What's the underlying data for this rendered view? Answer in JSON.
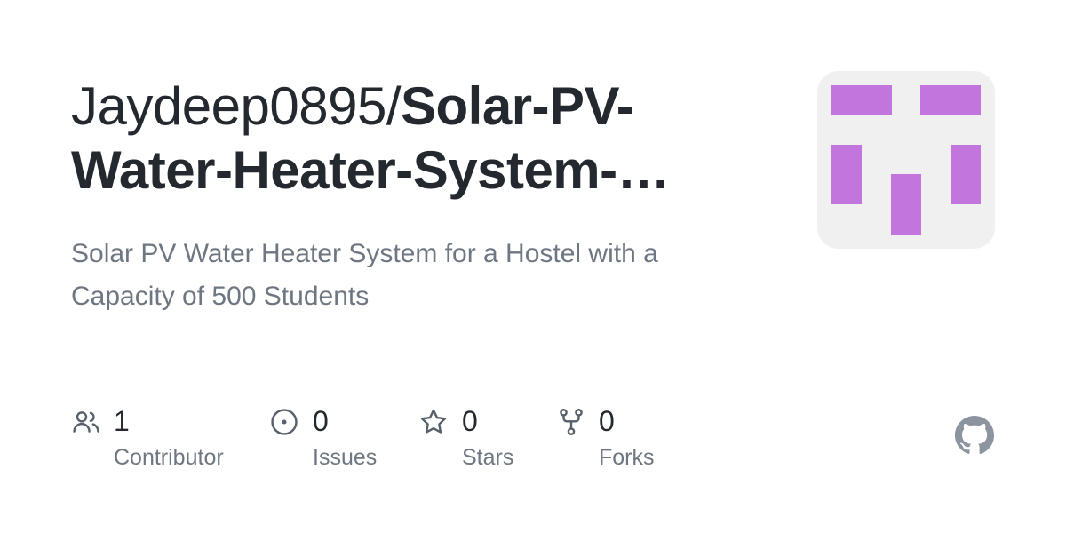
{
  "repo": {
    "owner": "Jaydeep0895/",
    "name": "Solar-PV-Water-Heater-System-…",
    "description": "Solar PV Water Heater System for a Hostel with a Capacity of 500 Students"
  },
  "avatar": {
    "background": "#f0f0f0",
    "pixel_color": "#c375de"
  },
  "stats": {
    "contributors": {
      "count": "1",
      "label": "Contributor",
      "icon": "people-icon"
    },
    "issues": {
      "count": "0",
      "label": "Issues",
      "icon": "issue-opened-icon"
    },
    "stars": {
      "count": "0",
      "label": "Stars",
      "icon": "star-icon"
    },
    "forks": {
      "count": "0",
      "label": "Forks",
      "icon": "repo-forked-icon"
    }
  },
  "colors": {
    "title": "#24292f",
    "muted": "#6e7781",
    "icon": "#57606a",
    "logo": "#8c959f"
  }
}
